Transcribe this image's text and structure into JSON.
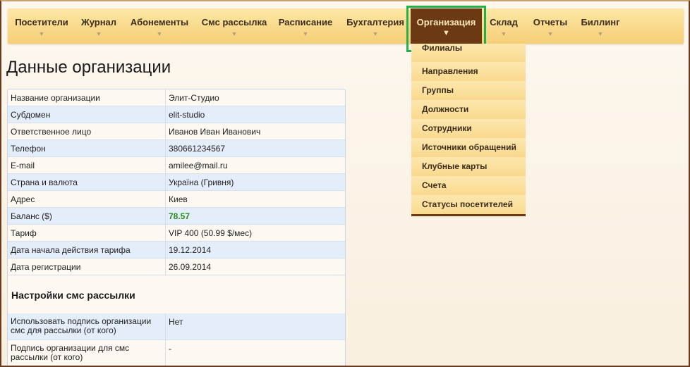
{
  "nav": {
    "items": [
      {
        "label": "Посетители"
      },
      {
        "label": "Журнал"
      },
      {
        "label": "Абонементы"
      },
      {
        "label": "Смс рассылка"
      },
      {
        "label": "Расписание"
      },
      {
        "label": "Бухгалтерия"
      },
      {
        "label": "Организация"
      },
      {
        "label": "Склад"
      },
      {
        "label": "Отчеты"
      },
      {
        "label": "Биллинг"
      }
    ],
    "arrow": "▼",
    "active_index": 6
  },
  "dropdown": {
    "items": [
      {
        "label": "Филиалы"
      },
      {
        "label": "Направления"
      },
      {
        "label": "Группы"
      },
      {
        "label": "Должности"
      },
      {
        "label": "Сотрудники"
      },
      {
        "label": "Источники обращений"
      },
      {
        "label": "Клубные карты"
      },
      {
        "label": "Счета"
      },
      {
        "label": "Статусы посетителей"
      }
    ]
  },
  "page": {
    "title": "Данные организации"
  },
  "org": {
    "rows": [
      {
        "label": "Название организации",
        "value": "Элит-Студио"
      },
      {
        "label": "Субдомен",
        "value": "elit-studio"
      },
      {
        "label": "Ответственное лицо",
        "value": "Иванов Иван Иванович"
      },
      {
        "label": "Телефон",
        "value": "380661234567"
      },
      {
        "label": "E-mail",
        "value": "amilee@mail.ru"
      },
      {
        "label": "Страна и валюта",
        "value": "Україна (Гривня)"
      },
      {
        "label": "Адрес",
        "value": "Киев"
      },
      {
        "label": "Баланс ($)",
        "value": "78.57"
      },
      {
        "label": "Тариф",
        "value": "VIP 400 (50.99 $/мес)"
      },
      {
        "label": "Дата начала действия тарифа",
        "value": "19.12.2014"
      },
      {
        "label": "Дата регистрации",
        "value": "26.09.2014"
      }
    ]
  },
  "sms": {
    "title": "Настройки смс рассылки",
    "rows": [
      {
        "label_line1": "Использовать подпись организации",
        "label_line2": "смс для рассылки (от кого)",
        "value": "Нет"
      },
      {
        "label_line1": "Подпись организации для смс",
        "label_line2": "рассылки (от кого)",
        "value": "-"
      }
    ]
  },
  "colors": {
    "nav_bg": "#f9d98a",
    "active_bg": "#6b3a12",
    "highlight_outline": "#22b04b",
    "balance": "#2a8a1e",
    "alt_row": "#e4eefa"
  }
}
